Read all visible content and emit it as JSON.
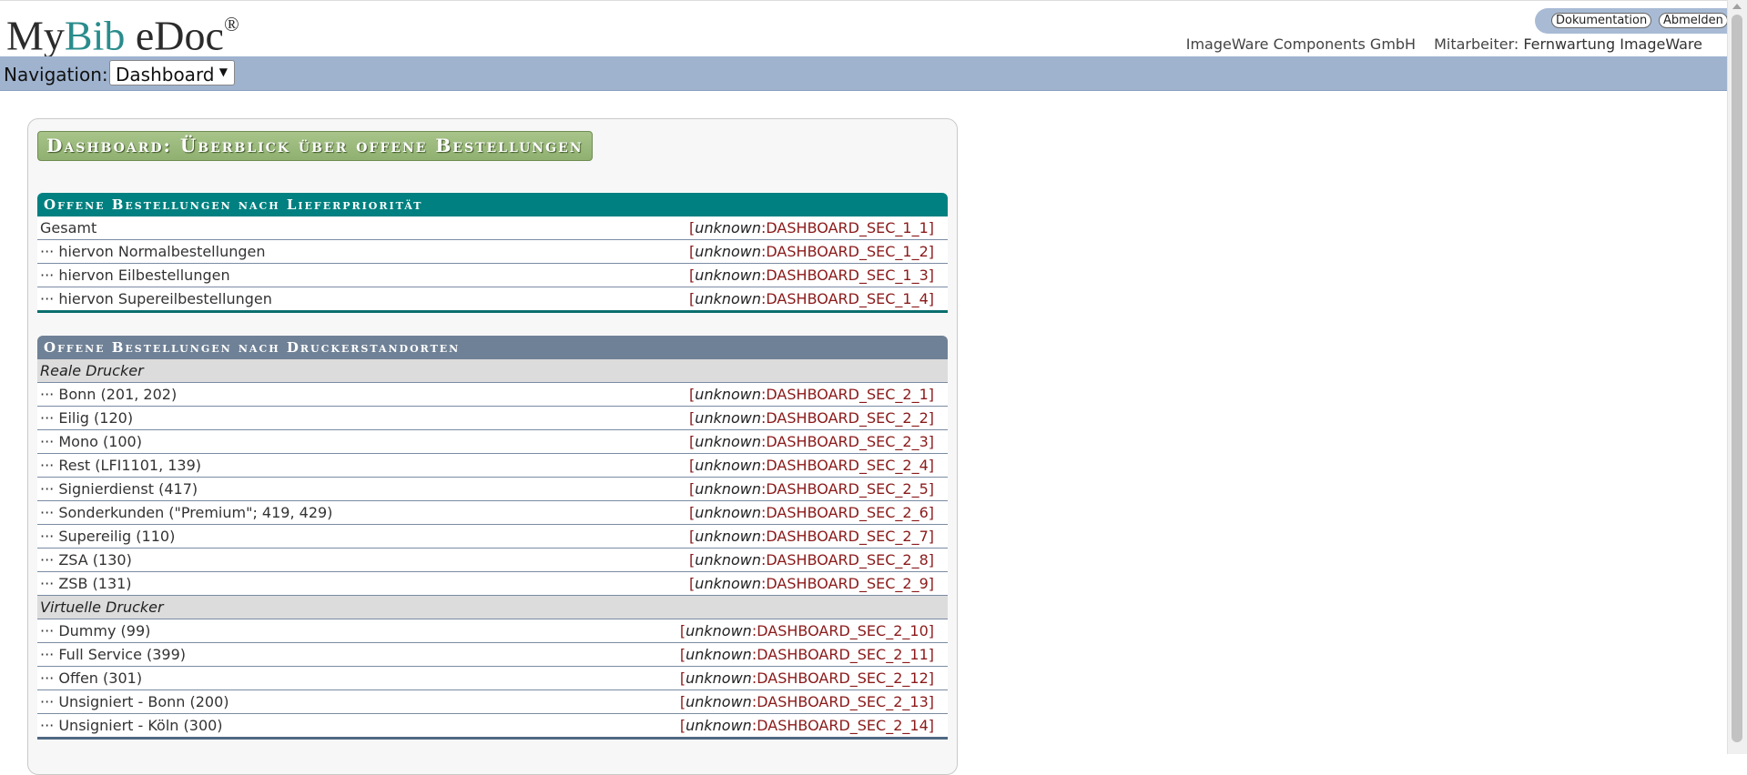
{
  "header": {
    "logo_my": "My",
    "logo_bib": "Bib",
    "logo_edoc": " eDoc",
    "logo_reg": "®",
    "btn_documentation": "Dokumentation",
    "btn_logout": "Abmelden",
    "company": "ImageWare Components GmbH",
    "employee_label": "Mitarbeiter:",
    "employee_name": "Fernwartung ImageWare"
  },
  "nav": {
    "label": "Navigation:",
    "selected": "Dashboard"
  },
  "page": {
    "title": "Dashboard: Überblick über offene Bestellungen"
  },
  "section1": {
    "title": "Offene Bestellungen nach Lieferpriorität",
    "rows": [
      {
        "label": "Gesamt",
        "prefix": "unknown",
        "value": "DASHBOARD_SEC_1_1"
      },
      {
        "label": "··· hiervon Normalbestellungen",
        "prefix": "unknown",
        "value": "DASHBOARD_SEC_1_2"
      },
      {
        "label": "··· hiervon Eilbestellungen",
        "prefix": "unknown",
        "value": "DASHBOARD_SEC_1_3"
      },
      {
        "label": "··· hiervon Supereilbestellungen",
        "prefix": "unknown",
        "value": "DASHBOARD_SEC_1_4"
      }
    ]
  },
  "section2": {
    "title": "Offene Bestellungen nach Druckerstandorten",
    "group_real": "Reale Drucker",
    "rows_real": [
      {
        "label": "··· Bonn (201, 202)",
        "prefix": "unknown",
        "value": "DASHBOARD_SEC_2_1"
      },
      {
        "label": "··· Eilig (120)",
        "prefix": "unknown",
        "value": "DASHBOARD_SEC_2_2"
      },
      {
        "label": "··· Mono (100)",
        "prefix": "unknown",
        "value": "DASHBOARD_SEC_2_3"
      },
      {
        "label": "··· Rest (LFI1101, 139)",
        "prefix": "unknown",
        "value": "DASHBOARD_SEC_2_4"
      },
      {
        "label": "··· Signierdienst (417)",
        "prefix": "unknown",
        "value": "DASHBOARD_SEC_2_5"
      },
      {
        "label": "··· Sonderkunden (\"Premium\"; 419, 429)",
        "prefix": "unknown",
        "value": "DASHBOARD_SEC_2_6"
      },
      {
        "label": "··· Supereilig (110)",
        "prefix": "unknown",
        "value": "DASHBOARD_SEC_2_7"
      },
      {
        "label": "··· ZSA (130)",
        "prefix": "unknown",
        "value": "DASHBOARD_SEC_2_8"
      },
      {
        "label": "··· ZSB (131)",
        "prefix": "unknown",
        "value": "DASHBOARD_SEC_2_9"
      }
    ],
    "group_virtual": "Virtuelle Drucker",
    "rows_virtual": [
      {
        "label": "··· Dummy (99)",
        "prefix": "unknown",
        "value": "DASHBOARD_SEC_2_10"
      },
      {
        "label": "··· Full Service (399)",
        "prefix": "unknown",
        "value": "DASHBOARD_SEC_2_11"
      },
      {
        "label": "··· Offen (301)",
        "prefix": "unknown",
        "value": "DASHBOARD_SEC_2_12"
      },
      {
        "label": "··· Unsigniert - Bonn (200)",
        "prefix": "unknown",
        "value": "DASHBOARD_SEC_2_13"
      },
      {
        "label": "··· Unsigniert - Köln (300)",
        "prefix": "unknown",
        "value": "DASHBOARD_SEC_2_14"
      }
    ]
  }
}
